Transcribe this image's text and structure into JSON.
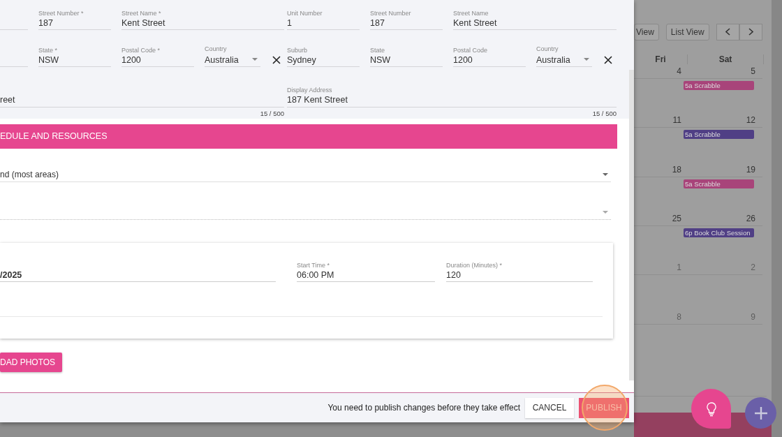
{
  "address_blocks": [
    {
      "row1": [
        {
          "kind": "partial"
        },
        {
          "kind": "text",
          "label": "Street Number *",
          "value": "187"
        },
        {
          "kind": "text",
          "label": "Street Name *",
          "value": "Kent Street"
        }
      ],
      "row2": [
        {
          "kind": "partial"
        },
        {
          "kind": "text",
          "label": "State *",
          "value": "NSW"
        },
        {
          "kind": "text",
          "label": "Postal Code *",
          "value": "1200"
        },
        {
          "kind": "select",
          "label": "Country",
          "value": "Australia"
        }
      ],
      "display": {
        "value": "reet",
        "counter": "15 / 500"
      }
    },
    {
      "row1": [
        {
          "kind": "text",
          "label": "Unit Number",
          "value": "1"
        },
        {
          "kind": "text",
          "label": "Street Number",
          "value": "187"
        },
        {
          "kind": "text",
          "label": "Street Name",
          "value": "Kent Street"
        }
      ],
      "row2": [
        {
          "kind": "text",
          "label": "Suburb",
          "value": "Sydney"
        },
        {
          "kind": "text",
          "label": "State",
          "value": "NSW"
        },
        {
          "kind": "text",
          "label": "Postal Code",
          "value": "1200"
        },
        {
          "kind": "select",
          "label": "Country",
          "value": "Australia"
        }
      ],
      "display": {
        "label": "Display Address",
        "value": "187 Kent Street",
        "counter": "15 / 500"
      }
    }
  ],
  "schedule": {
    "title": "EDULE AND RESOURCES",
    "selects": [
      {
        "value": "nd (most areas)",
        "dotted": false
      },
      {
        "dotted": true
      }
    ],
    "session": {
      "date": {
        "value": "/2025"
      },
      "start_time": {
        "label": "Start Time *",
        "value": "06:00 PM"
      },
      "duration": {
        "label": "Duration (Minutes) *",
        "value": "120"
      }
    },
    "upload_button": "DAD PHOTOS"
  },
  "footer": {
    "message": "You need to publish changes before they take effect",
    "cancel": "CANCEL",
    "publish": "PUBLISH"
  },
  "calendar": {
    "view_buttons": [
      "View",
      "List View"
    ],
    "days": [
      "Fri",
      "Sat"
    ],
    "weeks": [
      {
        "dates": [
          "4",
          "5"
        ],
        "other_month": false,
        "event": {
          "label": "5a Scrabble",
          "color": "#a8447a"
        }
      },
      {
        "dates": [
          "11",
          "12"
        ],
        "other_month": false,
        "event": {
          "label": "5a Scrabble",
          "color": "#503f85"
        }
      },
      {
        "dates": [
          "18",
          "19"
        ],
        "other_month": false,
        "event": {
          "label": "5a Scrabble",
          "color": "#a8447a"
        }
      },
      {
        "dates": [
          "25",
          "26"
        ],
        "other_month": false,
        "event": {
          "label": "6p Book Club Session",
          "color": "#503f85"
        }
      },
      {
        "dates": [
          "1",
          "2"
        ],
        "other_month": true
      },
      {
        "dates": [
          "8",
          "9"
        ],
        "other_month": true
      }
    ]
  }
}
